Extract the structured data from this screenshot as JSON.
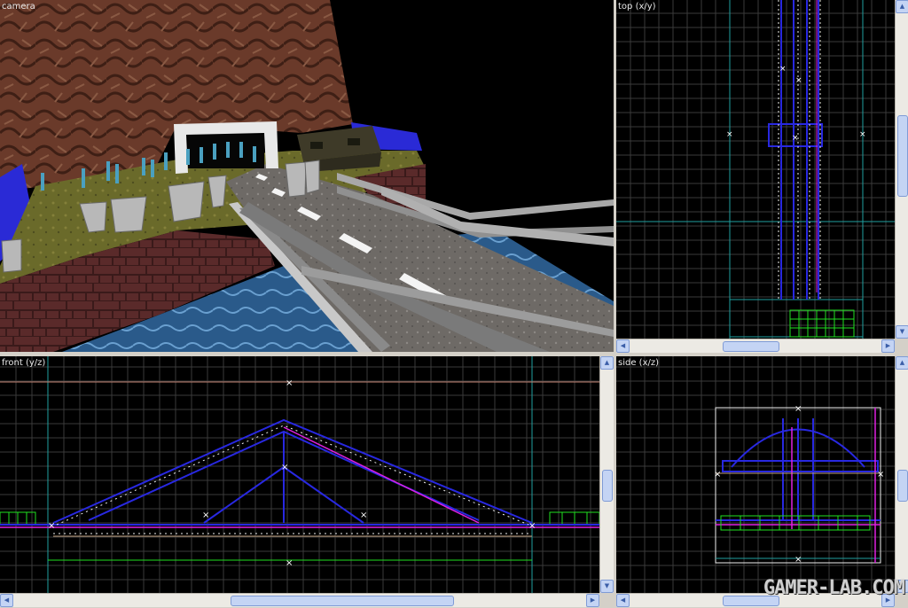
{
  "viewports": {
    "camera": {
      "label": "camera"
    },
    "top": {
      "label": "top (x/y)"
    },
    "front": {
      "label": "front (y/z)"
    },
    "side": {
      "label": "side (x/z)"
    }
  },
  "watermark": "GAMER-LAB.COM",
  "colors": {
    "grid": "#3a3a3a",
    "grid_major": "#5a5a5a",
    "brush_blue": "#2828e0",
    "brush_white": "#f0f0f0",
    "selection_magenta": "#e020e0",
    "entity_green": "#20e020",
    "axis_teal": "#20a0a0"
  }
}
